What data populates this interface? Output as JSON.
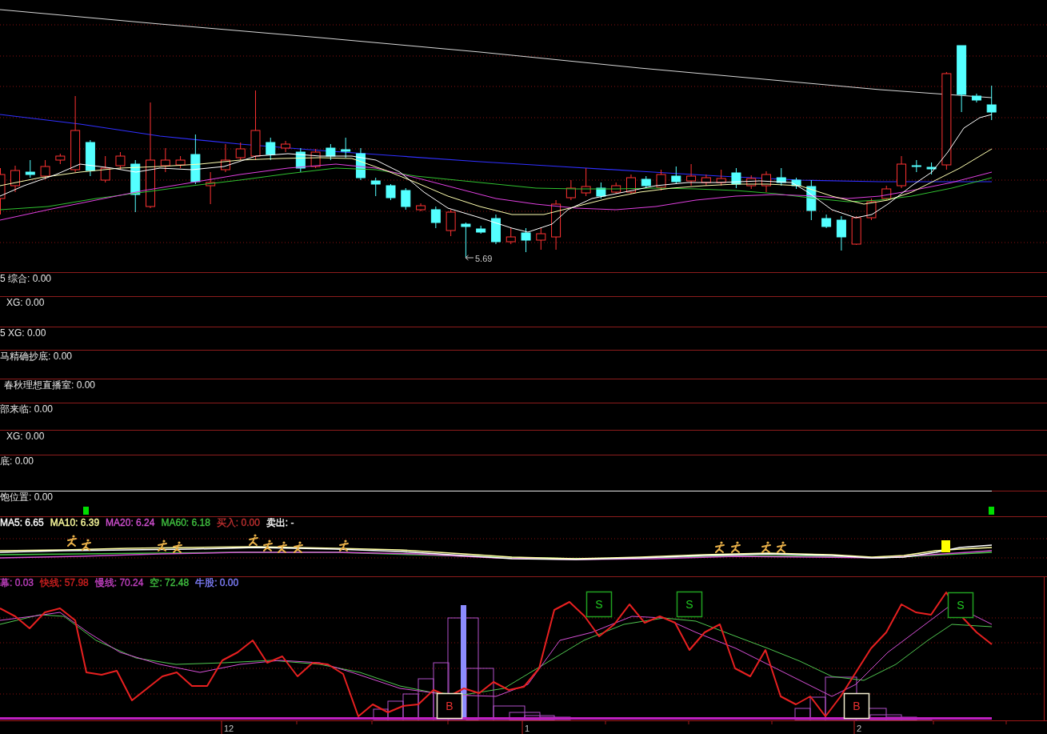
{
  "price_panel": {
    "low_label": "5.69"
  },
  "indicator_panels": [
    {
      "label": "5 综合: 0.00",
      "signal_marks": false
    },
    {
      "label": "XG: 0.00",
      "signal_marks": false
    },
    {
      "label": "5 XG: 0.00",
      "signal_marks": false
    },
    {
      "label": "马精确抄底: 0.00",
      "signal_marks": false
    },
    {
      "label": "春秋理想直播室: 0.00",
      "signal_marks": false
    },
    {
      "label": "部来临: 0.00",
      "signal_marks": false
    },
    {
      "label": "XG: 0.00",
      "signal_marks": false
    },
    {
      "label": "底: 0.00",
      "signal_marks": false
    },
    {
      "label": "饱位置: 0.00",
      "signal_marks": true
    }
  ],
  "ma_panel": {
    "legend": [
      {
        "text": "MA5: 6.65",
        "color": "#ffffff"
      },
      {
        "text": "MA10: 6.39",
        "color": "#ffffa0"
      },
      {
        "text": "MA20: 6.24",
        "color": "#d050d0"
      },
      {
        "text": "MA60: 6.18",
        "color": "#40c040"
      },
      {
        "text": "买入: 0.00",
        "color": "#c03030"
      },
      {
        "text": "卖出: -",
        "color": "#ffffff"
      }
    ]
  },
  "oscillator_panel": {
    "legend": [
      {
        "text": "幕: 0.03",
        "color": "#c040c0"
      },
      {
        "text": "快线: 57.98",
        "color": "#d02020"
      },
      {
        "text": "慢线: 70.24",
        "color": "#c040c0"
      },
      {
        "text": "空: 72.48",
        "color": "#40c040"
      },
      {
        "text": "牛股: 0.00",
        "color": "#8080ff"
      }
    ],
    "signals": [
      {
        "kind": "buy",
        "label": "B"
      },
      {
        "kind": "sell",
        "label": "S"
      },
      {
        "kind": "sell",
        "label": "S"
      },
      {
        "kind": "buy",
        "label": "B"
      },
      {
        "kind": "sell",
        "label": "S"
      }
    ]
  },
  "time_axis": {
    "labels": [
      "12",
      "1",
      "2"
    ]
  }
}
